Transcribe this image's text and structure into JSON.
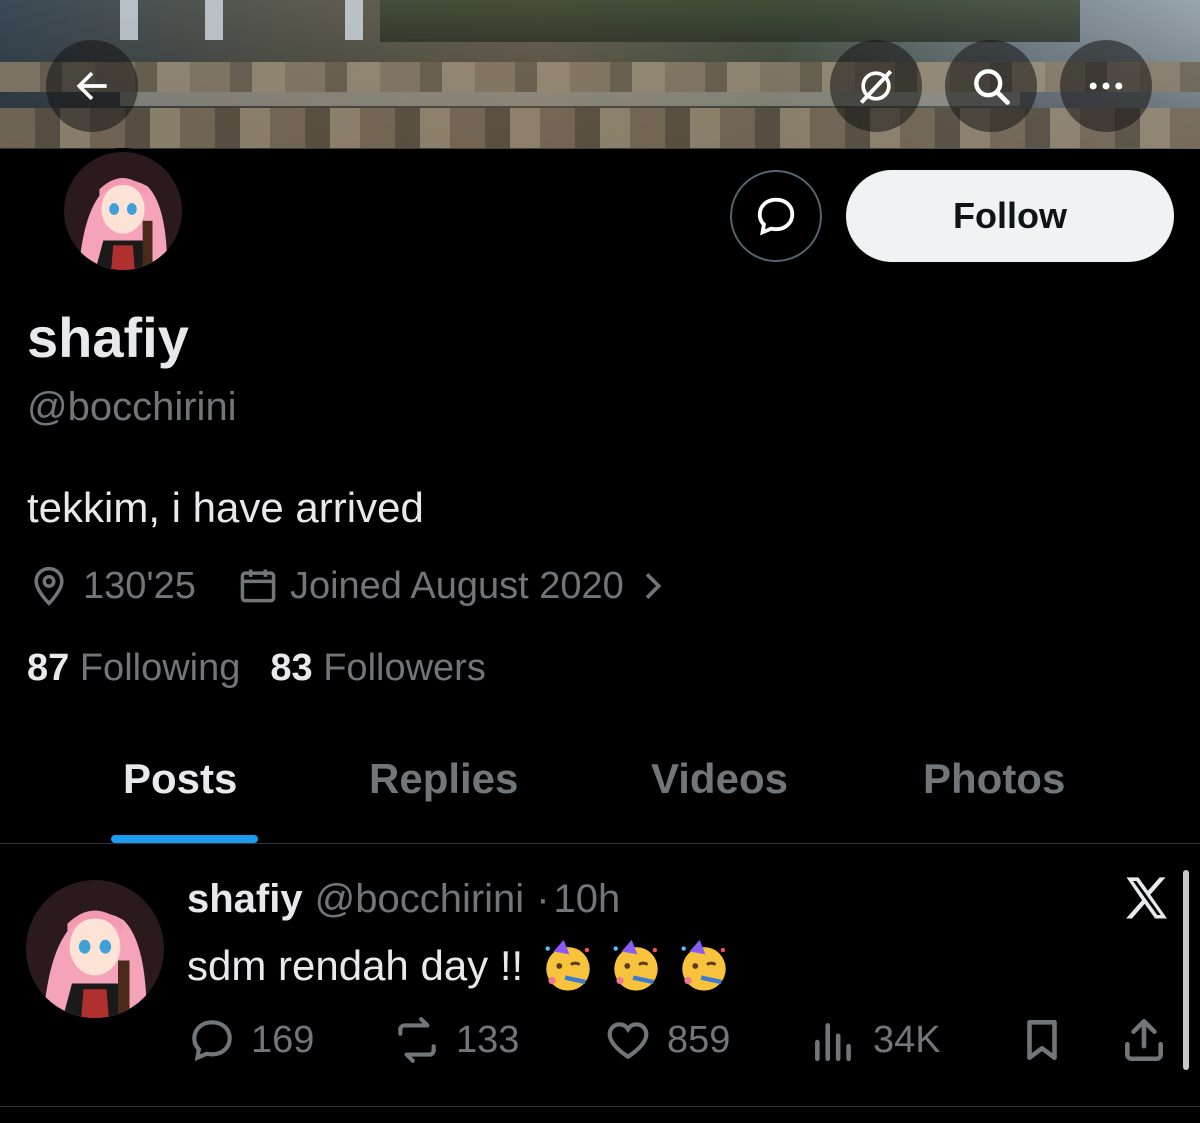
{
  "header": {
    "back_icon": "back-arrow-icon",
    "grok_icon": "grok-icon",
    "search_icon": "search-icon",
    "more_icon": "more-icon"
  },
  "profile": {
    "name": "shafiy",
    "handle": "@bocchirini",
    "bio": "tekkim, i have arrived",
    "location": "130'25",
    "joined": "Joined August 2020",
    "following_count": "87",
    "following_label": "Following",
    "followers_count": "83",
    "followers_label": "Followers",
    "follow_label": "Follow"
  },
  "tabs": [
    {
      "label": "Posts",
      "active": true
    },
    {
      "label": "Replies",
      "active": false
    },
    {
      "label": "Videos",
      "active": false
    },
    {
      "label": "Photos",
      "active": false
    }
  ],
  "post": {
    "name": "shafiy",
    "handle": "@bocchirini",
    "separator": "·",
    "time": "10h",
    "text": "sdm rendah day !!",
    "emoji": "partying-face",
    "replies": "169",
    "reposts": "133",
    "likes": "859",
    "views": "34K"
  },
  "colors": {
    "accent": "#1d9bf0",
    "muted": "#71767b",
    "text": "#e7e9ea",
    "border": "#2f3336",
    "background": "#000000"
  }
}
